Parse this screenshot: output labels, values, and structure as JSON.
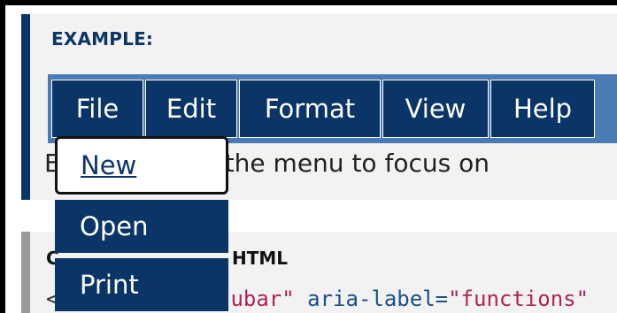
{
  "example": {
    "label": "EXAMPLE:"
  },
  "menubar": {
    "items": [
      {
        "label": "File"
      },
      {
        "label": "Edit"
      },
      {
        "label": "Format"
      },
      {
        "label": "View"
      },
      {
        "label": "Help"
      }
    ]
  },
  "dropdown": {
    "items": [
      {
        "label": "New",
        "state": "focused"
      },
      {
        "label": "Open"
      },
      {
        "label": "Print"
      }
    ]
  },
  "instruction": {
    "text": "the menu to focus on",
    "lead": "E"
  },
  "code": {
    "heading": "HTML",
    "lead": "C",
    "line_prefix": "<",
    "attr_tail": "ubar\"",
    "attr2": " aria-label=",
    "val2": "\"functions\""
  },
  "colors": {
    "menu_bg": "#0b3566",
    "menubar_bg": "#4a7bb5",
    "panel_bg": "#f2f2f2"
  }
}
